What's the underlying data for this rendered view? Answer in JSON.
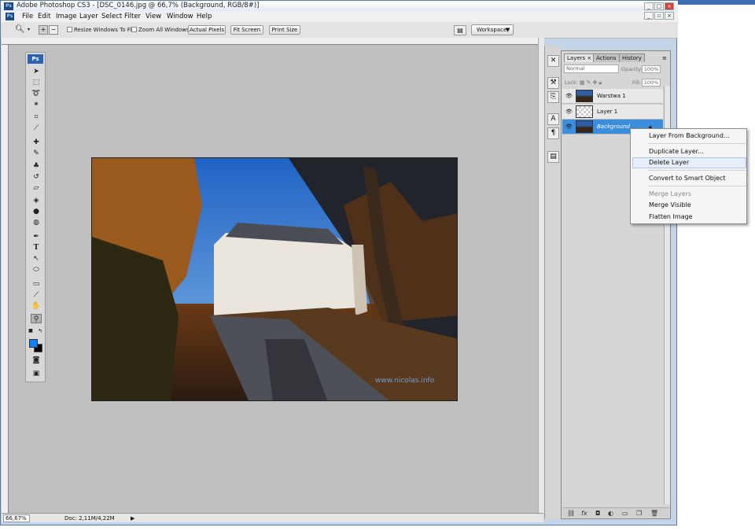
{
  "window": {
    "title": "Adobe Photoshop CS3 - [DSC_0146.jpg @ 66,7% (Background, RGB/8#)]",
    "app_icon": "Ps"
  },
  "menu": [
    "File",
    "Edit",
    "Image",
    "Layer",
    "Select",
    "Filter",
    "View",
    "Window",
    "Help"
  ],
  "options": {
    "resize_windows": "Resize Windows To Fit",
    "zoom_all": "Zoom All Windows",
    "actual_pixels": "Actual Pixels",
    "fit_screen": "Fit Screen",
    "print_size": "Print Size",
    "workspace": "Workspace"
  },
  "toolbox": {
    "logo": "Ps",
    "tools": [
      "move-tool",
      "marquee-tool",
      "lasso-tool",
      "magic-wand-tool",
      "crop-tool",
      "slice-tool",
      "healing-brush-tool",
      "brush-tool",
      "clone-stamp-tool",
      "history-brush-tool",
      "eraser-tool",
      "paint-bucket-tool",
      "blur-tool",
      "dodge-tool",
      "pen-tool",
      "type-tool",
      "path-selection-tool",
      "shape-tool",
      "notes-tool",
      "eyedropper-tool",
      "hand-tool",
      "zoom-tool"
    ],
    "foreground": "#0a82ff",
    "background": "#000000"
  },
  "status": {
    "zoom": "66,67%",
    "doc": "Doc: 2,11M/4,22M"
  },
  "panel": {
    "tabs": [
      "Layers",
      "Actions",
      "History"
    ],
    "blend_mode": "Normal",
    "opacity_label": "Opacity:",
    "opacity": "100%",
    "lock_label": "Lock:",
    "fill_label": "Fill:",
    "fill": "100%",
    "layers": [
      {
        "name": "Warstwa 1",
        "selected": false
      },
      {
        "name": "Layer 1",
        "selected": false
      },
      {
        "name": "Background",
        "selected": true
      }
    ]
  },
  "context_menu": {
    "items": [
      {
        "label": "Layer From Background...",
        "enabled": true
      },
      {
        "label": "Duplicate Layer...",
        "enabled": true
      },
      {
        "label": "Delete Layer",
        "enabled": true,
        "highlighted": true
      },
      {
        "label": "Convert to Smart Object",
        "enabled": true
      },
      {
        "label": "Merge Layers",
        "enabled": false
      },
      {
        "label": "Merge Visible",
        "enabled": true
      },
      {
        "label": "Flatten Image",
        "enabled": true
      }
    ]
  },
  "photo": {
    "watermark": "www.nicolas.info"
  },
  "colors": {
    "accent": "#3b8edb",
    "canvas": "#c0c0c0",
    "panel": "#d6d6d6"
  }
}
